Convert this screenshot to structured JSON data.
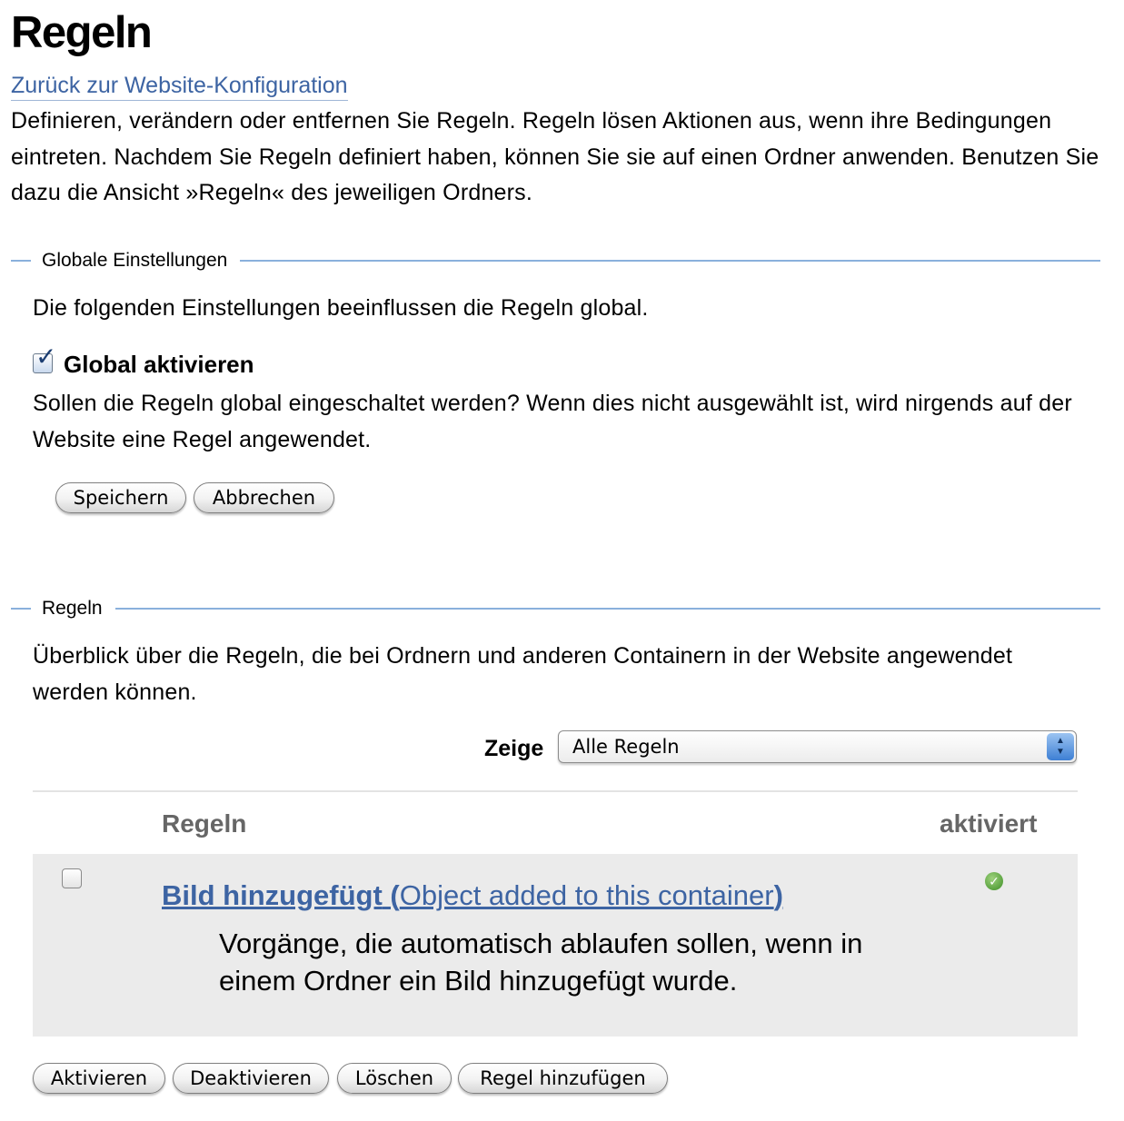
{
  "header": {
    "title": "Regeln",
    "back_link": "Zurück zur Website-Konfiguration",
    "intro": "Definieren, verändern oder entfernen Sie Regeln. Regeln lösen Aktionen aus, wenn ihre Bedingungen eintreten. Nachdem Sie Regeln definiert haben, können Sie sie auf einen Ordner anwenden. Benutzen Sie dazu die Ansicht »Regeln« des jeweiligen Ordners."
  },
  "global_settings": {
    "legend": "Globale Einstellungen",
    "description": "Die folgenden Einstellungen beeinflussen die Regeln global.",
    "enable_label": "Global aktivieren",
    "enable_checked": true,
    "enable_help": "Sollen die Regeln global eingeschaltet werden? Wenn dies nicht ausgewählt ist, wird nirgends auf der Website eine Regel angewendet.",
    "save_label": "Speichern",
    "cancel_label": "Abbrechen"
  },
  "rules": {
    "legend": "Regeln",
    "description": "Überblick über die Regeln, die bei Ordnern und anderen Containern in der Website angewendet werden können.",
    "filter_label": "Zeige",
    "filter_value": "Alle Regeln",
    "columns": {
      "rules": "Regeln",
      "enabled": "aktiviert"
    },
    "items": [
      {
        "name": "Bild hinzugefügt",
        "paren_open": " (",
        "event": "Object added to this container",
        "paren_close": ")",
        "description": "Vorgänge, die automatisch ablaufen sollen, wenn in einem Ordner ein Bild hinzugefügt wurde.",
        "enabled": true,
        "enabled_icon": "check-circle-icon"
      }
    ],
    "buttons": {
      "activate": "Aktivieren",
      "deactivate": "Deaktivieren",
      "delete": "Löschen",
      "add": "Regel hinzufügen"
    }
  },
  "colors": {
    "link": "#3d64a3",
    "section_rule": "#8ab0dc",
    "row_background": "#ebebeb",
    "enabled_icon": "#3c8e24"
  }
}
